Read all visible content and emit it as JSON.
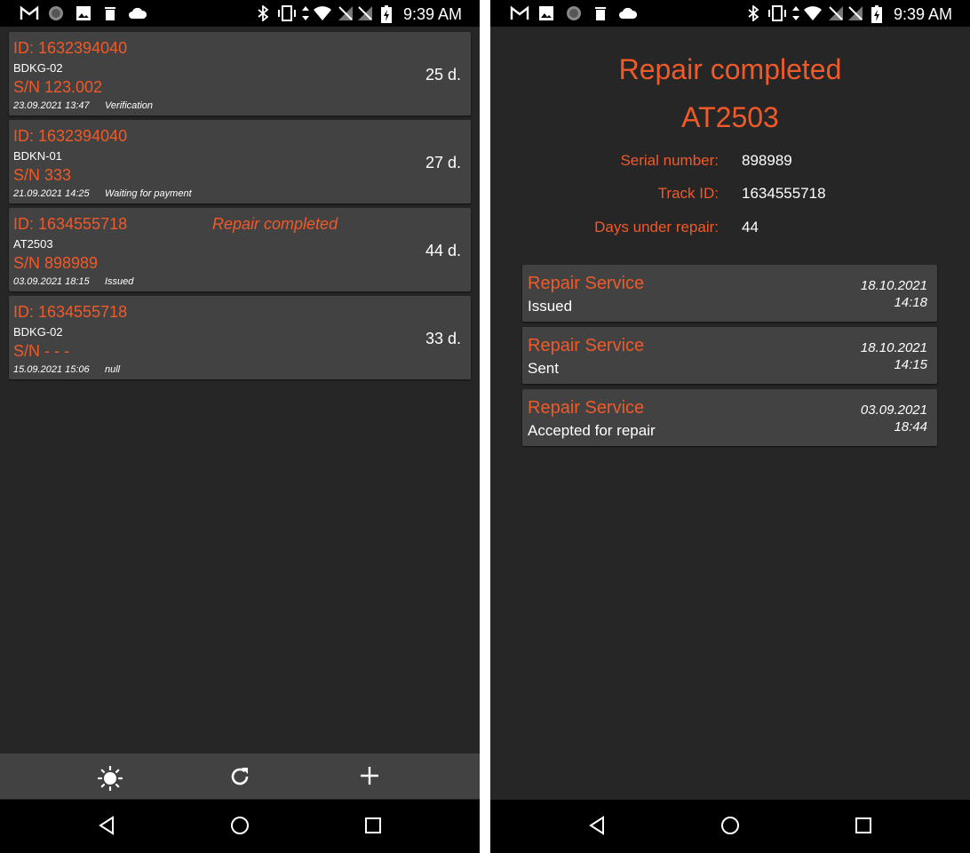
{
  "status_bar": {
    "time": "9:39 AM"
  },
  "list_screen": {
    "items": [
      {
        "id": "ID: 1632394040",
        "model": "BDKG-02",
        "serial": "S/N 123.002",
        "date": "23.09.2021 13:47",
        "state": "Verification",
        "days": "25 d.",
        "badge": ""
      },
      {
        "id": "ID: 1632394040",
        "model": "BDKN-01",
        "serial": "S/N 333",
        "date": "21.09.2021 14:25",
        "state": "Waiting for payment",
        "days": "27 d.",
        "badge": ""
      },
      {
        "id": "ID: 1634555718",
        "model": "AT2503",
        "serial": "S/N 898989",
        "date": "03.09.2021 18:15",
        "state": "Issued",
        "days": "44 d.",
        "badge": "Repair completed"
      },
      {
        "id": "ID: 1634555718",
        "model": "BDKG-02",
        "serial": "S/N - - -",
        "date": "15.09.2021 15:06",
        "state": "null",
        "days": "33 d.",
        "badge": ""
      }
    ],
    "toolbar": {
      "icons": [
        "brightness-icon",
        "refresh-icon",
        "add-icon"
      ]
    }
  },
  "detail_screen": {
    "title": "Repair completed",
    "model": "AT2503",
    "fields": [
      {
        "label": "Serial number:",
        "value": "898989"
      },
      {
        "label": "Track ID:",
        "value": "1634555718"
      },
      {
        "label": "Days under repair:",
        "value": "44"
      }
    ],
    "history": [
      {
        "org": "Repair Service",
        "status": "Issued",
        "date": "18.10.2021",
        "time": "14:18"
      },
      {
        "org": "Repair Service",
        "status": "Sent",
        "date": "18.10.2021",
        "time": "14:15"
      },
      {
        "org": "Repair Service",
        "status": "Accepted for repair",
        "date": "03.09.2021",
        "time": "18:44"
      }
    ]
  },
  "colors": {
    "accent": "#f05a28",
    "background": "#262626",
    "card": "#424242"
  }
}
